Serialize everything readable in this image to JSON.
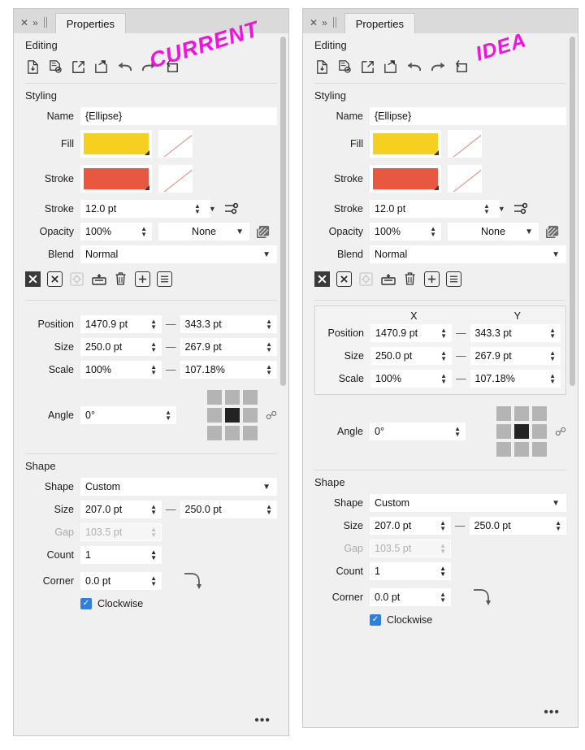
{
  "annotations": {
    "left": "CURRENT",
    "right": "IDEA",
    "color": "#f410e0"
  },
  "panel": {
    "tab_label": "Properties",
    "close_icon": "close-icon",
    "chevron_icon": "chevron-double-right-icon",
    "sections": {
      "editing": "Editing",
      "styling": "Styling",
      "shape": "Shape"
    },
    "toolbar_icons": [
      "import-document-icon",
      "place-document-icon",
      "open-external-icon",
      "share-export-icon",
      "undo-icon",
      "redo-icon",
      "replace-loop-icon"
    ],
    "action_icons": [
      "delete-filled-icon",
      "delete-outline-icon",
      "settings-gear-icon",
      "flatten-icon",
      "trash-icon",
      "add-icon",
      "list-icon"
    ],
    "styling": {
      "name_label": "Name",
      "name_value": "{Ellipse}",
      "fill_label": "Fill",
      "fill_color": "#f5d020",
      "fill_none_label": "none-swatch",
      "stroke_label": "Stroke",
      "stroke_color": "#e8573f",
      "stroke_none_label": "none-swatch",
      "stroke_width_label": "Stroke",
      "stroke_width_value": "12.0 pt",
      "stroke_options_icon": "stroke-options-icon",
      "opacity_label": "Opacity",
      "opacity_value": "100%",
      "blendmode_select_value": "None",
      "layer_effects_icon": "layer-effects-icon",
      "blend_label": "Blend",
      "blend_value": "Normal"
    },
    "transform": {
      "col_x": "X",
      "col_y": "Y",
      "position_label": "Position",
      "position_x": "1470.9 pt",
      "position_y": "343.3 pt",
      "size_label": "Size",
      "size_x": "250.0 pt",
      "size_y": "267.9 pt",
      "scale_label": "Scale",
      "scale_x": "100%",
      "scale_y": "107.18%",
      "angle_label": "Angle",
      "angle_value": "0°",
      "anchor_icon": "anchor-grid",
      "anchor_selected_index": 4,
      "link_icon": "link-chain-icon"
    },
    "shape": {
      "shape_label": "Shape",
      "shape_value": "Custom",
      "size_label": "Size",
      "size_x": "207.0 pt",
      "size_y": "250.0 pt",
      "gap_label": "Gap",
      "gap_value": "103.5 pt",
      "count_label": "Count",
      "count_value": "1",
      "corner_label": "Corner",
      "corner_value": "0.0 pt",
      "corner_icon": "corner-curve-icon",
      "clockwise_label": "Clockwise",
      "clockwise_checked": true
    },
    "overflow_label": "•••"
  }
}
